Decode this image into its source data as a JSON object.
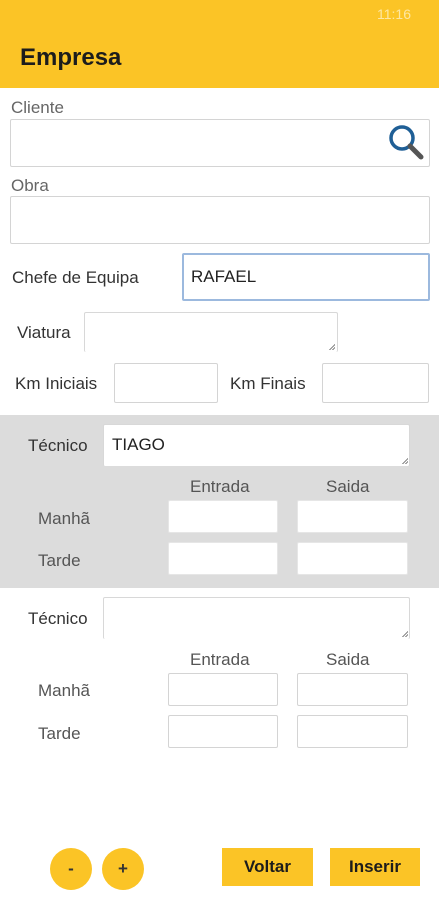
{
  "status_bar": {
    "time": "11:16"
  },
  "header": {
    "title": "Empresa"
  },
  "form": {
    "cliente": {
      "label": "Cliente",
      "value": ""
    },
    "obra": {
      "label": "Obra",
      "value": ""
    },
    "chefe": {
      "label": "Chefe de Equipa",
      "value": "RAFAEL"
    },
    "viatura": {
      "label": "Viatura",
      "value": ""
    },
    "km_iniciais": {
      "label": "Km Iniciais",
      "value": ""
    },
    "km_finais": {
      "label": "Km Finais",
      "value": ""
    }
  },
  "tecnicos": [
    {
      "label": "Técnico",
      "value": "TIAGO",
      "col_entrada": "Entrada",
      "col_saida": "Saida",
      "manha_label": "Manhã",
      "tarde_label": "Tarde",
      "manha_entrada": "",
      "manha_saida": "",
      "tarde_entrada": "",
      "tarde_saida": ""
    },
    {
      "label": "Técnico",
      "value": "",
      "col_entrada": "Entrada",
      "col_saida": "Saida",
      "manha_label": "Manhã",
      "tarde_label": "Tarde",
      "manha_entrada": "",
      "manha_saida": "",
      "tarde_entrada": "",
      "tarde_saida": ""
    }
  ],
  "footer": {
    "minus_label": "-",
    "plus_label": "+",
    "voltar_label": "Voltar",
    "inserir_label": "Inserir"
  },
  "colors": {
    "accent": "#fbc426",
    "panel": "#dcdcdc",
    "focus_border": "#9cb9de",
    "search_icon": "#1f5f96"
  },
  "icons": {
    "search": "search-icon"
  }
}
